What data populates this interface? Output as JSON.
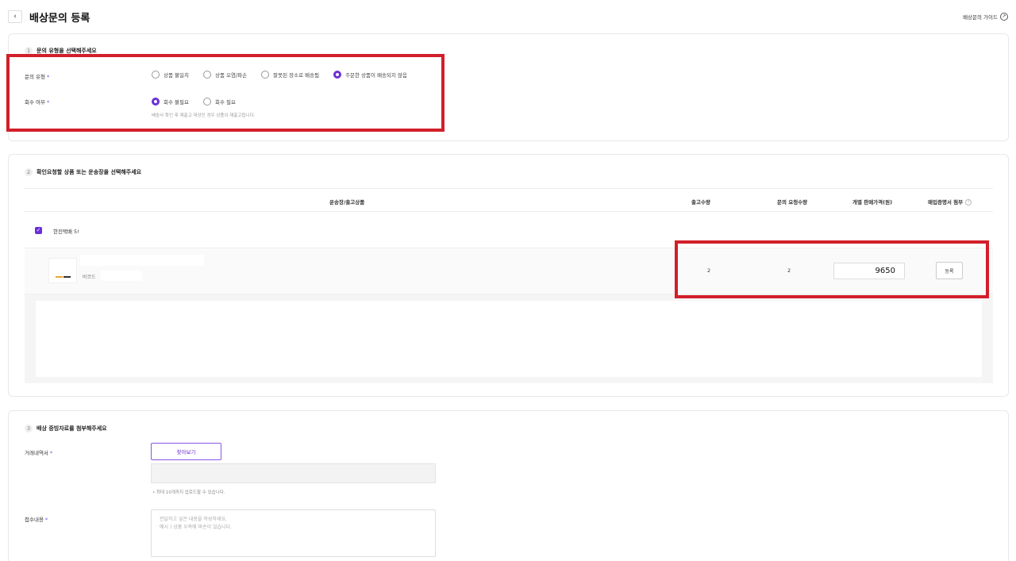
{
  "header": {
    "back_icon": "chevron-left-icon",
    "back_glyph": "‹",
    "title": "배상문의 등록",
    "guide_label": "배상문의 가이드",
    "guide_icon": "arrow-circle-icon",
    "guide_glyph": "↗"
  },
  "section1": {
    "step": "1",
    "title": "문의 유형을 선택해주세요",
    "inquiry_type": {
      "label": "문의 유형",
      "required_mark": "*",
      "options": [
        {
          "label": "상품 불일치",
          "selected": false
        },
        {
          "label": "상품 오염/파손",
          "selected": false
        },
        {
          "label": "잘못된 장소로 배송됨",
          "selected": false
        },
        {
          "label": "주문한 상품이 배송되지 않음",
          "selected": true
        }
      ]
    },
    "return_needed": {
      "label": "회수 여부",
      "required_mark": "*",
      "options": [
        {
          "label": "회수 불필요",
          "selected": true
        },
        {
          "label": "회수 필요",
          "selected": false
        }
      ],
      "hint": "배송사 확인 후 재출고 대상인 경우 상품이 재출고됩니다."
    }
  },
  "section2": {
    "step": "2",
    "title": "확인요청할 상품 또는 운송장을 선택해주세요",
    "columns": {
      "product": "운송장/출고상품",
      "shipped_qty": "출고수량",
      "request_qty": "문의 요청수량",
      "unit_price": "개별 판매가격(원)",
      "proof": "매입증명서 첨부",
      "proof_help_glyph": "?"
    },
    "carrier": {
      "checked": true,
      "check_glyph": "✓",
      "name": "한진택배 5!"
    },
    "item": {
      "barcode_label": "바코드",
      "shipped_qty": "2",
      "request_qty": "2",
      "unit_price": "9650",
      "register_label": "등록"
    }
  },
  "section3": {
    "step": "3",
    "title": "배상 증빙자료를 첨부해주세요",
    "statement": {
      "label": "거래내역서",
      "required_mark": "*",
      "find_button": "찾아보기",
      "upload_note": "• 최대 10개까지 업로드할 수 있습니다."
    },
    "content": {
      "label": "접수내용",
      "required_mark": "*",
      "placeholder": "전달하고 싶은 내용을 작성하세요.\n예시 ) 상품 우측에 파손이 있습니다."
    }
  },
  "colors": {
    "accent": "#6a2fd6",
    "highlight_box": "#d21f2a"
  }
}
